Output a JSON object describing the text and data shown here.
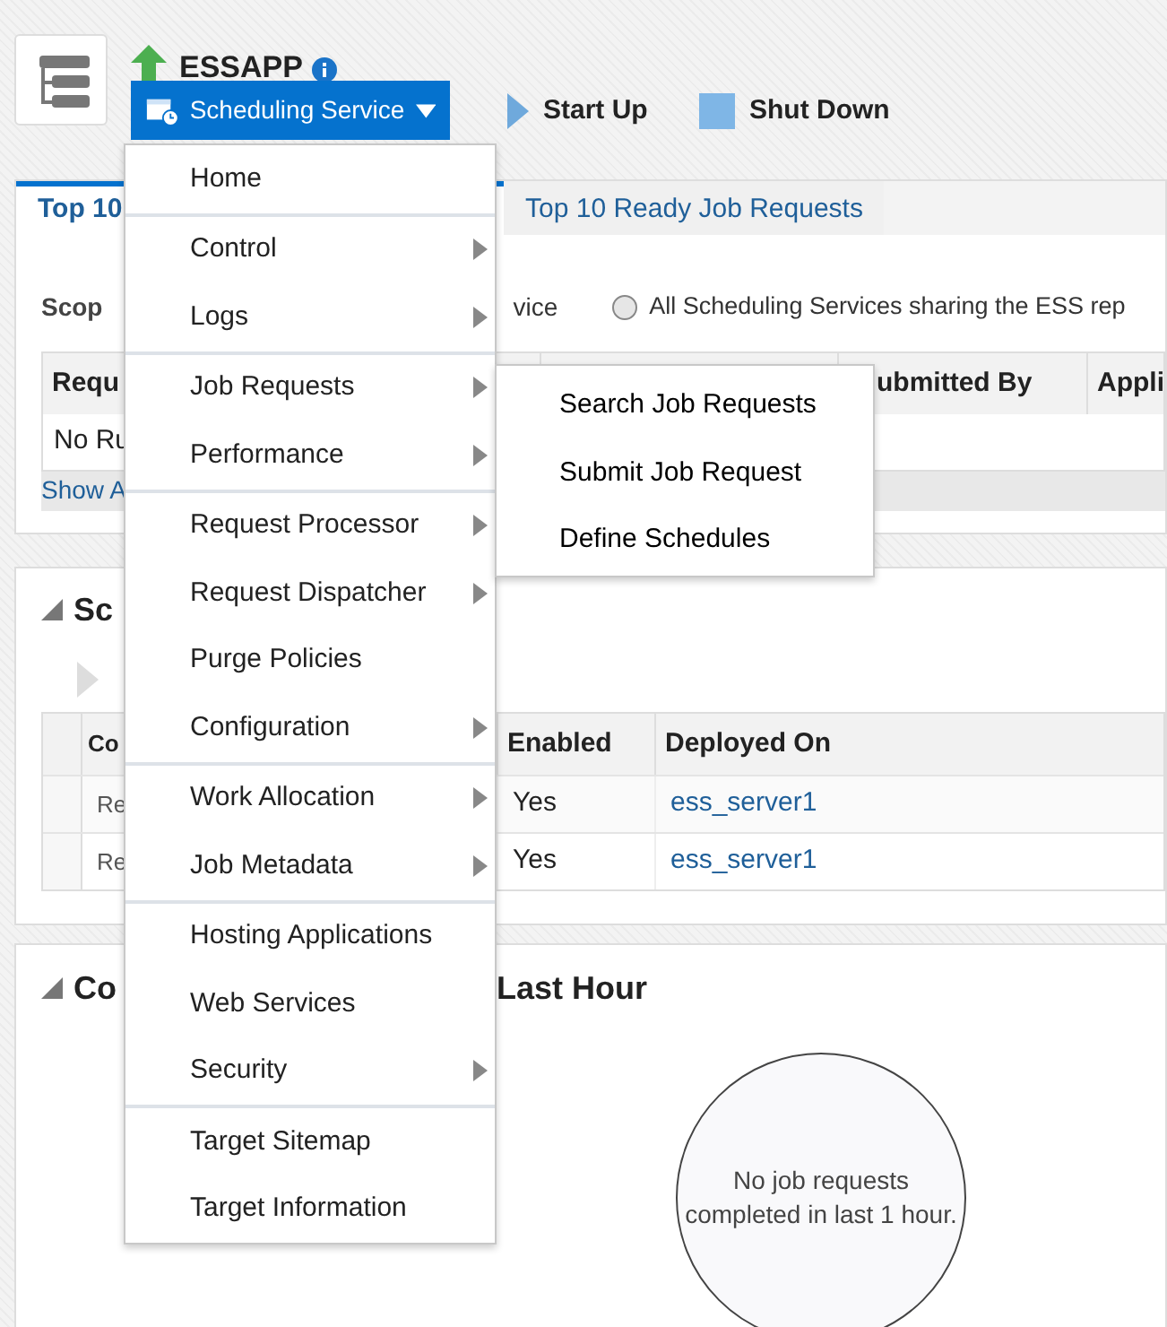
{
  "header": {
    "title": "ESSAPP",
    "target_button": "Scheduling Service",
    "actions": [
      {
        "label": "Start Up",
        "kind": "start"
      },
      {
        "label": "Shut Down",
        "kind": "stop"
      }
    ]
  },
  "tabs": [
    {
      "label": "Top 10",
      "selected": true
    },
    {
      "label": "Top 10 Ready Job Requests",
      "selected": false
    }
  ],
  "scope": {
    "label": "Scop",
    "option_1_text": "vice",
    "option_2": {
      "label": "All Scheduling Services sharing the ESS rep",
      "selected": false
    }
  },
  "requests_table": {
    "columns": [
      "Requ",
      "ubmitted By",
      "Appli"
    ],
    "empty_text": "No Ru",
    "link": "Show A"
  },
  "components_section": {
    "title": "Sc",
    "table": {
      "columns": [
        "Co",
        "Enabled",
        "Deployed On"
      ],
      "rows": [
        [
          "Re",
          "Yes",
          "ess_server1"
        ],
        [
          "Re",
          "Yes",
          "ess_server1"
        ]
      ]
    }
  },
  "completed_section": {
    "title_start": "Co",
    "title_end": "Last Hour",
    "empty_text": "No job requests completed in last 1 hour."
  },
  "menu": {
    "groups": [
      [
        {
          "label": "Home",
          "submenu": false
        }
      ],
      [
        {
          "label": "Control",
          "submenu": true
        },
        {
          "label": "Logs",
          "submenu": true
        }
      ],
      [
        {
          "label": "Job Requests",
          "submenu": true
        },
        {
          "label": "Performance",
          "submenu": true
        }
      ],
      [
        {
          "label": "Request Processor",
          "submenu": true
        },
        {
          "label": "Request Dispatcher",
          "submenu": true
        },
        {
          "label": "Purge Policies",
          "submenu": false
        },
        {
          "label": "Configuration",
          "submenu": true
        }
      ],
      [
        {
          "label": "Work Allocation",
          "submenu": true
        },
        {
          "label": "Job Metadata",
          "submenu": true
        }
      ],
      [
        {
          "label": "Hosting Applications",
          "submenu": false
        },
        {
          "label": "Web Services",
          "submenu": false
        },
        {
          "label": "Security",
          "submenu": true
        }
      ],
      [
        {
          "label": "Target Sitemap",
          "submenu": false
        },
        {
          "label": "Target Information",
          "submenu": false
        }
      ]
    ]
  },
  "submenu": [
    "Search Job Requests",
    "Submit Job Request",
    "Define Schedules"
  ]
}
